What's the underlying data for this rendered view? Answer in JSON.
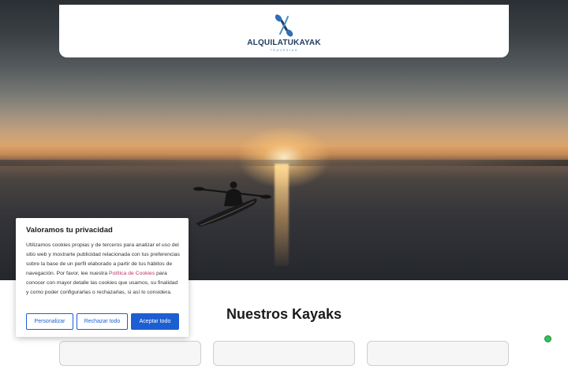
{
  "header": {
    "logo_text": "ALQUILATUKAYAK",
    "logo_tagline": "TRAVESÍAS",
    "logo_icon": "kayak-paddle-logo-icon"
  },
  "hero": {
    "image": "sunset-kayaker-photo"
  },
  "cookie_banner": {
    "title": "Valoramos tu privacidad",
    "text_before_link": "Utilizamos cookies propias y de terceros para analizar el uso del sitio web y mostrarte publicidad relacionada con tus preferencias sobre la base de un perfil elaborado a partir de tus hábitos de navegación. Por favor, lee nuestra ",
    "link_text": "Política de Cookies",
    "text_after_link": " para conocer con mayor detalle las cookies que usamos, su finalidad y como poder configurarlas o rechazarlas, si así lo considera.",
    "buttons": {
      "customize": "Personalizar",
      "reject": "Rechazar todo",
      "accept": "Aceptar todo"
    }
  },
  "main": {
    "section_title": "Nuestros Kayaks"
  },
  "colors": {
    "primary": "#1d5fd1",
    "link": "#c0306b",
    "logo_dark": "#1f3a5f",
    "logo_light": "#4a8ec9"
  }
}
